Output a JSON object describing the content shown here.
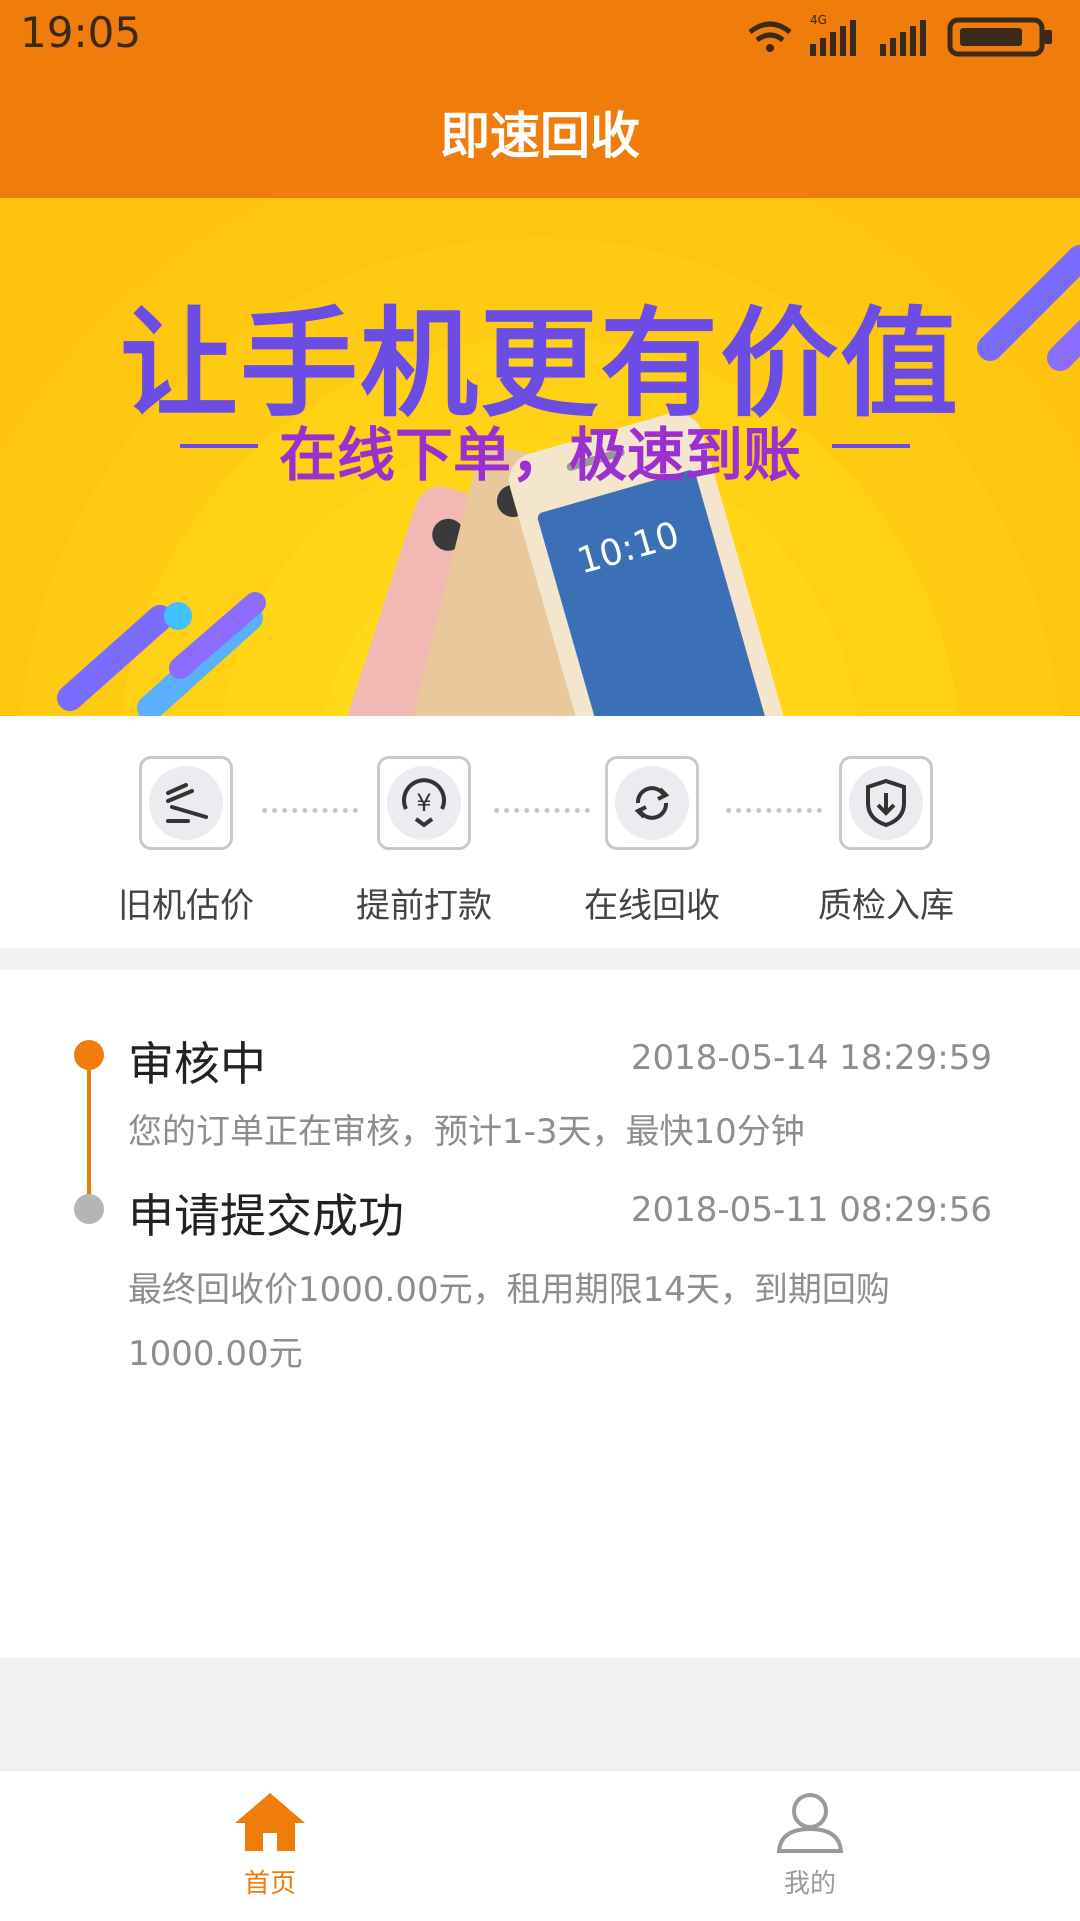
{
  "status_bar": {
    "time": "19:05",
    "network": "4G"
  },
  "header": {
    "title": "即速回收"
  },
  "banner": {
    "headline": "让手机更有价值",
    "subline": "在线下单，极速到账"
  },
  "steps": [
    {
      "label": "旧机估价",
      "icon": "gavel-icon"
    },
    {
      "label": "提前打款",
      "icon": "yen-icon"
    },
    {
      "label": "在线回收",
      "icon": "refresh-icon"
    },
    {
      "label": "质检入库",
      "icon": "shield-download-icon"
    }
  ],
  "timeline": [
    {
      "title": "审核中",
      "time": "2018-05-14 18:29:59",
      "desc": "您的订单正在审核，预计1-3天，最快10分钟",
      "status_color": "#ef7c0b"
    },
    {
      "title": "申请提交成功",
      "time": "2018-05-11 08:29:56",
      "desc": "最终回收价1000.00元，租用期限14天，到期回购1000.00元",
      "status_color": "#b5b5b5"
    }
  ],
  "nav": {
    "home_label": "首页",
    "mine_label": "我的",
    "active_color": "#ef7c0b",
    "inactive_color": "#9a9a9a"
  }
}
